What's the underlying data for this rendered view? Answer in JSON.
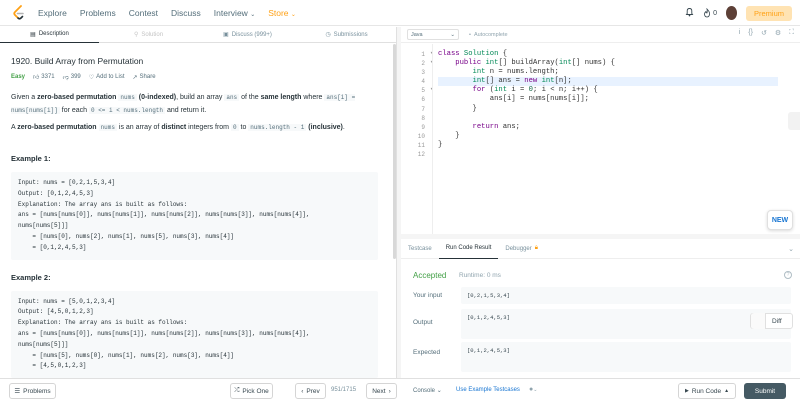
{
  "nav": {
    "links": [
      "Explore",
      "Problems",
      "Contest",
      "Discuss",
      "Interview",
      "Store"
    ],
    "coins": "0",
    "premium": "Premium"
  },
  "tabs": [
    "Description",
    "Solution",
    "Discuss (999+)",
    "Submissions"
  ],
  "problem": {
    "title": "1920. Build Array from Permutation",
    "difficulty": "Easy",
    "likes": "3371",
    "dislikes": "399",
    "add_to_list": "Add to List",
    "share": "Share",
    "p1": {
      "t1": "Given a ",
      "b1": "zero-based permutation",
      "c1": "nums",
      "b2": "(0-indexed)",
      "t2": ", build an array ",
      "c2": "ans",
      "t3": " of the ",
      "b3": "same length",
      "t4": " where ",
      "c3": "ans[i] = nums[nums[i]]",
      "t5": " for each ",
      "c4": "0 <= i < nums.length",
      "t6": " and return it."
    },
    "p2": {
      "t1": "A ",
      "b1": "zero-based permutation",
      "c1": "nums",
      "t2": " is an array of ",
      "b2": "distinct",
      "t3": " integers from ",
      "c2": "0",
      "t4": " to ",
      "c3": "nums.length - 1",
      "b3": "(inclusive)",
      "t5": "."
    },
    "example1": {
      "heading": "Example 1:",
      "body": "Input: nums = [0,2,1,5,3,4]\nOutput: [0,1,2,4,5,3]\nExplanation: The array ans is built as follows:\nans = [nums[nums[0]], nums[nums[1]], nums[nums[2]], nums[nums[3]], nums[nums[4]],\nnums[nums[5]]]\n    = [nums[0], nums[2], nums[1], nums[5], nums[3], nums[4]]\n    = [0,1,2,4,5,3]"
    },
    "example2": {
      "heading": "Example 2:",
      "body": "Input: nums = [5,0,1,2,3,4]\nOutput: [4,5,0,1,2,3]\nExplanation: The array ans is built as follows:\nans = [nums[nums[0]], nums[nums[1]], nums[nums[2]], nums[nums[3]], nums[nums[4]],\nnums[nums[5]]]\n    = [nums[5], nums[0], nums[1], nums[2], nums[3], nums[4]]\n    = [4,5,0,1,2,3]"
    }
  },
  "editor": {
    "language": "Java",
    "autocomplete": "Autocomplete",
    "line_numbers": [
      "1",
      "2",
      "3",
      "4",
      "5",
      "6",
      "7",
      "8",
      "9",
      "10",
      "11",
      "12"
    ],
    "new_badge": "NEW"
  },
  "console": {
    "tabs": [
      "Testcase",
      "Run Code Result",
      "Debugger"
    ],
    "status": "Accepted",
    "runtime": "Runtime: 0 ms",
    "your_input_label": "Your input",
    "your_input": "[0,2,1,5,3,4]",
    "output_label": "Output",
    "output": "[0,1,2,4,5,3]",
    "expected_label": "Expected",
    "expected": "[0,1,2,4,5,3]",
    "diff": "Diff"
  },
  "bottom": {
    "problems": "Problems",
    "pick_one": "Pick One",
    "prev": "Prev",
    "page": "951/1715",
    "next": "Next",
    "console": "Console",
    "use_example": "Use Example Testcases",
    "run_code": "Run Code",
    "submit": "Submit"
  }
}
